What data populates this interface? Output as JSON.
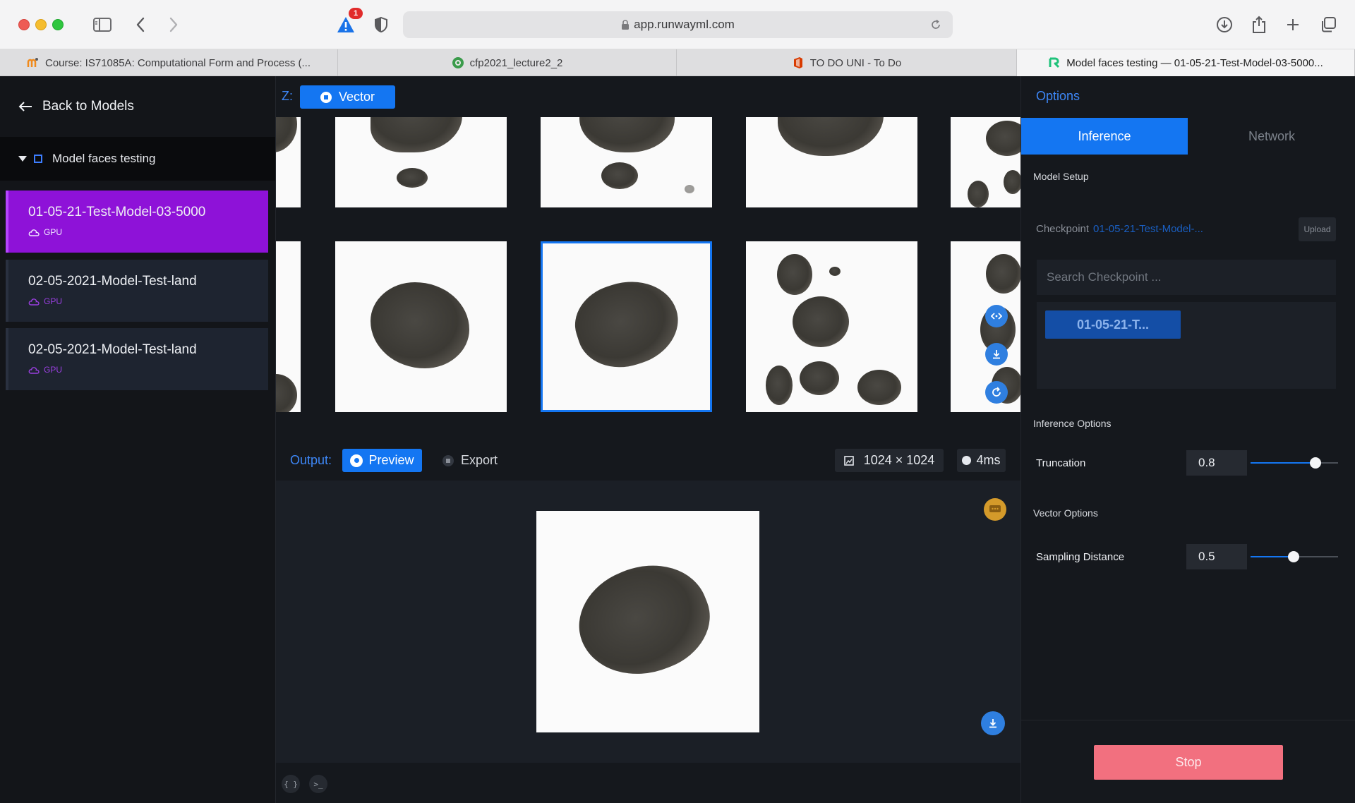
{
  "browser": {
    "url": "app.runwayml.com",
    "alert_badge": "1",
    "tabs": [
      {
        "label": "Course: IS71085A: Computational Form and Process (..."
      },
      {
        "label": "cfp2021_lecture2_2"
      },
      {
        "label": "TO DO UNI - To Do"
      },
      {
        "label": "Model faces testing — 01-05-21-Test-Model-03-5000..."
      }
    ]
  },
  "sidebar": {
    "back_label": "Back to Models",
    "group_label": "Model faces testing",
    "models": [
      {
        "name": "01-05-21-Test-Model-03-5000",
        "badge": "GPU",
        "selected": true
      },
      {
        "name": "02-05-2021-Model-Test-land",
        "badge": "GPU",
        "selected": false
      },
      {
        "name": "02-05-2021-Model-Test-land",
        "badge": "GPU",
        "selected": false
      }
    ]
  },
  "center": {
    "z_label": "Z:",
    "vector_label": "Vector",
    "output_label": "Output:",
    "preview_label": "Preview",
    "export_label": "Export",
    "resolution": "1024 × 1024",
    "latency": "4ms"
  },
  "options": {
    "title": "Options",
    "tab_inference": "Inference",
    "tab_network": "Network",
    "model_setup_title": "Model Setup",
    "checkpoint_label": "Checkpoint",
    "checkpoint_value": "01-05-21-Test-Model-...",
    "upload_label": "Upload",
    "search_placeholder": "Search Checkpoint ...",
    "checkpoint_chip": "01-05-21-T...",
    "inference_options_title": "Inference Options",
    "truncation_label": "Truncation",
    "truncation_value": "0.8",
    "vector_options_title": "Vector Options",
    "sampling_label": "Sampling Distance",
    "sampling_value": "0.5",
    "stop_label": "Stop"
  },
  "colors": {
    "accent": "#1476f2",
    "selected_model": "#8e12d8",
    "stop": "#f2707f"
  }
}
